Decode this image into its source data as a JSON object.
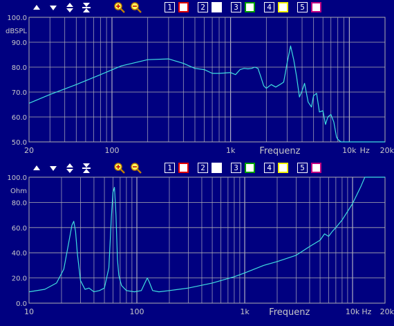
{
  "toolbar": {
    "buttons": [
      "arrow-up",
      "arrow-down",
      "arrow-updown",
      "compress",
      "zoom-in",
      "zoom-out"
    ],
    "channels": [
      {
        "num": "1",
        "color": "#e00000"
      },
      {
        "num": "2",
        "color": "#ffffff"
      },
      {
        "num": "3",
        "color": "#00a000"
      },
      {
        "num": "4",
        "color": "#f0f000"
      },
      {
        "num": "5",
        "color": "#c00080"
      }
    ]
  },
  "chart_data": [
    {
      "type": "line",
      "xlabel": "Frequenz",
      "x_unit": "Hz",
      "ylabel": "dBSPL",
      "xscale": "log",
      "xlim": [
        20,
        20000
      ],
      "ylim": [
        50,
        100
      ],
      "y_ticks": [
        "100.0",
        "90.0",
        "80.0",
        "70.0",
        "60.0",
        "50.0"
      ],
      "x_ticks": [
        "20",
        "100",
        "1k",
        "10k",
        "20k"
      ],
      "grid": true,
      "series": [
        {
          "color": "#40e0e0",
          "x": [
            20,
            30,
            50,
            80,
            120,
            200,
            300,
            400,
            500,
            600,
            700,
            800,
            1000,
            1100,
            1200,
            1300,
            1400,
            1500,
            1600,
            1700,
            1800,
            1900,
            2000,
            2200,
            2400,
            2600,
            2800,
            3000,
            3200,
            3400,
            3600,
            3800,
            4000,
            4200,
            4500,
            4800,
            5000,
            5300,
            5600,
            6000,
            6300,
            6600,
            7000,
            7400,
            7800,
            8000,
            8500,
            9000,
            10000,
            20000
          ],
          "y": [
            65.5,
            69,
            73,
            77,
            80.5,
            83,
            83.3,
            81.5,
            79.5,
            79,
            77.5,
            77.5,
            77.8,
            77,
            79,
            79.5,
            79.3,
            79.5,
            80,
            79.5,
            76,
            72.5,
            71.5,
            73,
            72,
            73,
            74,
            82,
            88.5,
            83,
            76,
            68,
            70.5,
            73.5,
            66,
            64,
            68.5,
            69.5,
            62,
            62.5,
            57,
            60,
            61,
            58,
            52,
            51,
            50,
            50,
            50,
            50
          ]
        }
      ]
    },
    {
      "type": "line",
      "xlabel": "Frequenz",
      "x_unit": "Hz",
      "ylabel": "Ohm",
      "xscale": "log",
      "xlim": [
        10,
        20000
      ],
      "ylim": [
        0,
        100
      ],
      "y_ticks": [
        "100.0",
        "80.0",
        "60.0",
        "40.0",
        "20.0",
        "0.0"
      ],
      "x_ticks": [
        "10",
        "100",
        "1k",
        "10k",
        "20k"
      ],
      "grid": true,
      "series": [
        {
          "color": "#40e0e0",
          "x": [
            10,
            14,
            18,
            21,
            23,
            25,
            26,
            27,
            28,
            30,
            33,
            36,
            40,
            45,
            50,
            55,
            58,
            60,
            62,
            64,
            66,
            68,
            72,
            80,
            95,
            110,
            120,
            125,
            130,
            140,
            160,
            200,
            300,
            500,
            800,
            1000,
            1500,
            2000,
            3000,
            4000,
            5000,
            5500,
            6000,
            6500,
            7000,
            8000,
            10000,
            12000,
            13000,
            14000,
            20000
          ],
          "y": [
            9,
            11,
            16,
            27,
            45,
            62,
            65,
            57,
            40,
            18,
            11,
            12,
            9,
            10,
            12,
            28,
            68,
            88,
            92,
            70,
            35,
            22,
            14,
            10,
            9,
            10,
            17,
            20,
            17,
            10,
            9,
            10,
            12,
            16,
            21,
            24,
            30,
            33,
            38,
            45,
            50,
            55,
            53,
            57,
            60,
            66,
            79,
            93,
            100,
            100,
            100
          ]
        }
      ]
    }
  ]
}
